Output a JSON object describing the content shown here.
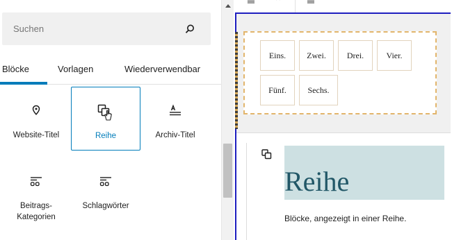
{
  "search": {
    "placeholder": "Suchen",
    "icon": "search-icon"
  },
  "tabs": [
    {
      "label": "Blöcke",
      "active": true
    },
    {
      "label": "Vorlagen",
      "active": false
    },
    {
      "label": "Wiederverwendbar",
      "active": false
    }
  ],
  "blocks": [
    {
      "label": "Website-Titel",
      "icon": "map-marker-icon",
      "selected": false
    },
    {
      "label": "Reihe",
      "icon": "row-block-icon",
      "selected": true
    },
    {
      "label": "Archiv-Titel",
      "icon": "archive-title-icon",
      "selected": false
    },
    {
      "label": "Beitrags-Kategorien",
      "icon": "categories-icon",
      "selected": false
    },
    {
      "label": "Schlagwörter",
      "icon": "tags-icon",
      "selected": false
    }
  ],
  "preview": {
    "items": [
      "Eins.",
      "Zwei.",
      "Drei.",
      "Vier.",
      "Fünf.",
      "Sechs."
    ],
    "title": "Reihe",
    "description": "Blöcke, angezeigt in einer Reihe."
  },
  "colors": {
    "accent": "#007cba",
    "preview_border": "#1d1dbf",
    "dashed": "#e2b56b",
    "title_bg": "#cde0e2",
    "title_text": "#215767"
  }
}
